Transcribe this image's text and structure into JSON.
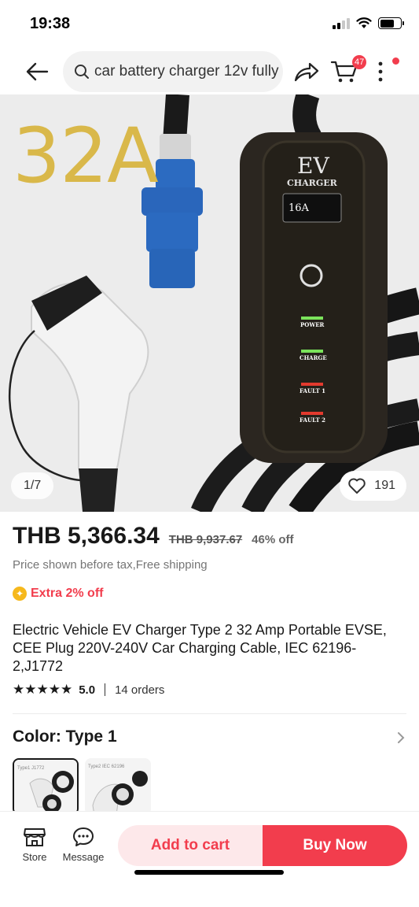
{
  "status_bar": {
    "time": "19:38"
  },
  "nav": {
    "search_query": "car battery charger 12v fully",
    "cart_count": "47"
  },
  "gallery": {
    "overlay_text": "32A",
    "counter": "1/7",
    "wishlist_count": "191",
    "product_label_ev": "EV",
    "product_label_charger": "CHARGER",
    "screen_amps": "16A",
    "indicators": [
      "POWER",
      "CHARGE",
      "FAULT 1",
      "FAULT 2"
    ]
  },
  "price": {
    "current": "THB 5,366.34",
    "original": "THB 9,937.67",
    "discount": "46% off",
    "note": "Price shown before tax,Free shipping"
  },
  "promo": {
    "label": "Extra 2% off"
  },
  "product": {
    "title": "Electric Vehicle EV Charger Type 2 32 Amp Portable EVSE, CEE Plug 220V-240V Car Charging Cable, IEC 62196-2,J1772",
    "rating": "5.0",
    "stars": 5,
    "orders": "14 orders"
  },
  "variants": {
    "label": "Color: Type  1",
    "options": [
      {
        "caption": "Type1  J1772",
        "selected": true
      },
      {
        "caption": "Type2  IEC 62196",
        "selected": false
      }
    ]
  },
  "bottom_bar": {
    "store_label": "Store",
    "message_label": "Message",
    "add_to_cart_label": "Add to cart",
    "buy_now_label": "Buy Now"
  },
  "colors": {
    "accent": "#f23d4d",
    "accent_light": "#fde8ea",
    "gold_overlay": "#d9b84a"
  }
}
